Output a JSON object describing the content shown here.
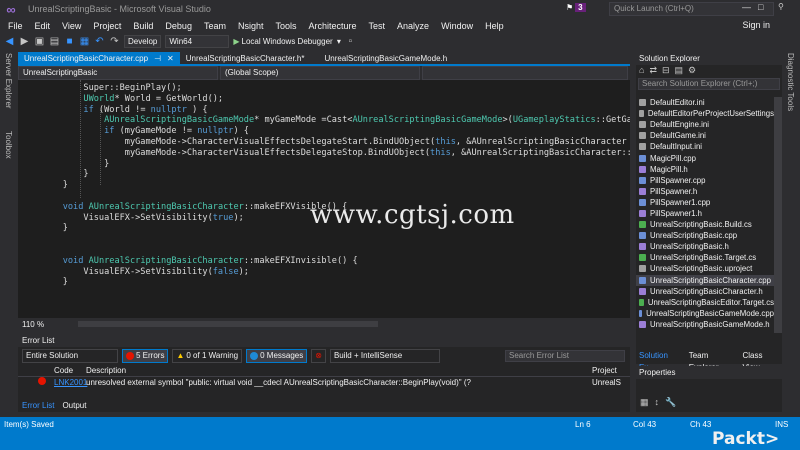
{
  "window": {
    "title": "UnrealScriptingBasic - Microsoft Visual Studio",
    "notifications": "3",
    "quick_launch_placeholder": "Quick Launch (Ctrl+Q)",
    "sign_in": "Sign in",
    "minimize": "—",
    "maximize": "□",
    "close": "✕"
  },
  "menu": [
    "File",
    "Edit",
    "View",
    "Project",
    "Build",
    "Debug",
    "Team",
    "Nsight",
    "Tools",
    "Architecture",
    "Test",
    "Analyze",
    "Window",
    "Help"
  ],
  "toolbar": {
    "configuration": "Develop",
    "platform": "Win64",
    "debugger": "Local Windows Debugger"
  },
  "left_tabs": [
    "Server Explorer",
    "Toolbox"
  ],
  "right_tabs": [
    "Diagnostic Tools"
  ],
  "doc_tabs": [
    {
      "label": "UnrealScriptingBasicCharacter.cpp",
      "active": true
    },
    {
      "label": "UnrealScriptingBasicCharacter.h*",
      "active": false
    },
    {
      "label": "UnrealScriptingBasicGameMode.h",
      "active": false
    }
  ],
  "nav": {
    "project": "UnrealScriptingBasic",
    "scope": "(Global Scope)"
  },
  "code_lines": [
    [
      [
        "",
        "        Super::BeginPlay();"
      ]
    ],
    [
      [
        "ty",
        "        UWorld"
      ],
      [
        "",
        "* World = GetWorld();"
      ]
    ],
    [
      [
        "kw",
        "        if"
      ],
      [
        "",
        " (World != "
      ],
      [
        "kw",
        "nullptr"
      ],
      [
        "",
        " ) {"
      ]
    ],
    [
      [
        "ty",
        "            AUnrealScriptingBasicGameMode"
      ],
      [
        "",
        "* myGameMode =Cast<"
      ],
      [
        "ty",
        "AUnrealScriptingBasicGameMode"
      ],
      [
        "",
        ">("
      ],
      [
        "ty",
        "UGameplayStatics"
      ],
      [
        "",
        "::GetGa"
      ]
    ],
    [
      [
        "kw",
        "            if"
      ],
      [
        "",
        " (myGameMode != "
      ],
      [
        "kw",
        "nullptr"
      ],
      [
        "",
        ") {"
      ]
    ],
    [
      [
        "",
        "                myGameMode->CharacterVisualEffectsDelegateStart.BindUObject("
      ],
      [
        "kw",
        "this"
      ],
      [
        "",
        ", &AUnrealScriptingBasicCharacter"
      ]
    ],
    [
      [
        "",
        "                myGameMode->CharacterVisualEffectsDelegateStop.BindUObject("
      ],
      [
        "kw",
        "this"
      ],
      [
        "",
        ", &AUnrealScriptingBasicCharacter::"
      ]
    ],
    [
      [
        "",
        "            }"
      ]
    ],
    [
      [
        "",
        "        }"
      ]
    ],
    [
      [
        "",
        "    }"
      ]
    ],
    [
      [
        "",
        ""
      ]
    ],
    [
      [
        "kw",
        "    void"
      ],
      [
        "",
        " "
      ],
      [
        "ty",
        "AUnrealScriptingBasicCharacter"
      ],
      [
        "",
        "::makeEFXVisible() {"
      ]
    ],
    [
      [
        "",
        "        VisualEFX->SetVisibility("
      ],
      [
        "kw",
        "true"
      ],
      [
        "",
        ");"
      ]
    ],
    [
      [
        "",
        "    }"
      ]
    ],
    [
      [
        "",
        ""
      ]
    ],
    [
      [
        "",
        ""
      ]
    ],
    [
      [
        "kw",
        "    void"
      ],
      [
        "",
        " "
      ],
      [
        "ty",
        "AUnrealScriptingBasicCharacter"
      ],
      [
        "",
        "::makeEFXInvisible() {"
      ]
    ],
    [
      [
        "",
        "        VisualEFX->SetVisibility("
      ],
      [
        "kw",
        "false"
      ],
      [
        "",
        ");"
      ]
    ],
    [
      [
        "",
        "    }"
      ]
    ]
  ],
  "watermark": "www.cgtsj.com",
  "zoom": "110 %",
  "error_list": {
    "title": "Error List",
    "scope": "Entire Solution",
    "errors": "5 Errors",
    "warnings": "0 of 1 Warning",
    "messages": "0 Messages",
    "build_filter": "Build + IntelliSense",
    "search_placeholder": "Search Error List",
    "columns": {
      "code": "Code",
      "description": "Description",
      "project": "Project"
    },
    "row": {
      "code": "LNK2001",
      "description": "unresolved external symbol \"public: virtual void __cdecl AUnrealScriptingBasicCharacter::BeginPlay(void)\" (?",
      "project": "UnrealS"
    }
  },
  "bottom_tabs": [
    "Error List",
    "Output"
  ],
  "solution_explorer": {
    "title": "Solution Explorer",
    "search_placeholder": "Search Solution Explorer (Ctrl+;)",
    "items": [
      {
        "label": "DefaultEditor.ini",
        "icon": "ini",
        "selected": false
      },
      {
        "label": "DefaultEditorPerProjectUserSettings",
        "icon": "ini",
        "selected": false
      },
      {
        "label": "DefaultEngine.ini",
        "icon": "ini",
        "selected": false
      },
      {
        "label": "DefaultGame.ini",
        "icon": "ini",
        "selected": false
      },
      {
        "label": "DefaultInput.ini",
        "icon": "ini",
        "selected": false
      },
      {
        "label": "MagicPill.cpp",
        "icon": "cpp",
        "selected": false
      },
      {
        "label": "MagicPill.h",
        "icon": "h",
        "selected": false
      },
      {
        "label": "PillSpawner.cpp",
        "icon": "cpp",
        "selected": false
      },
      {
        "label": "PillSpawner.h",
        "icon": "h",
        "selected": false
      },
      {
        "label": "PillSpawner1.cpp",
        "icon": "cpp",
        "selected": false
      },
      {
        "label": "PillSpawner1.h",
        "icon": "h",
        "selected": false
      },
      {
        "label": "UnrealScriptingBasic.Build.cs",
        "icon": "cs",
        "selected": false
      },
      {
        "label": "UnrealScriptingBasic.cpp",
        "icon": "cpp",
        "selected": false
      },
      {
        "label": "UnrealScriptingBasic.h",
        "icon": "h",
        "selected": false
      },
      {
        "label": "UnrealScriptingBasic.Target.cs",
        "icon": "cs",
        "selected": false
      },
      {
        "label": "UnrealScriptingBasic.uproject",
        "icon": "ini",
        "selected": false
      },
      {
        "label": "UnrealScriptingBasicCharacter.cpp",
        "icon": "cpp",
        "selected": true
      },
      {
        "label": "UnrealScriptingBasicCharacter.h",
        "icon": "h",
        "selected": false
      },
      {
        "label": "UnrealScriptingBasicEditor.Target.cs",
        "icon": "cs",
        "selected": false
      },
      {
        "label": "UnrealScriptingBasicGameMode.cpp",
        "icon": "cpp",
        "selected": false
      },
      {
        "label": "UnrealScriptingBasicGameMode.h",
        "icon": "h",
        "selected": false
      }
    ],
    "tabs": [
      "Solution Ex...",
      "Team Explorer",
      "Class View"
    ]
  },
  "properties": {
    "title": "Properties"
  },
  "status": {
    "left": "Item(s) Saved",
    "ln": "Ln 6",
    "col": "Col 43",
    "ch": "Ch 43",
    "ins": "INS",
    "brand": "Packt>"
  },
  "colors": {
    "accent": "#007acc",
    "keyword": "#569cd6",
    "type": "#4ec9b0",
    "error": "#e51400"
  }
}
